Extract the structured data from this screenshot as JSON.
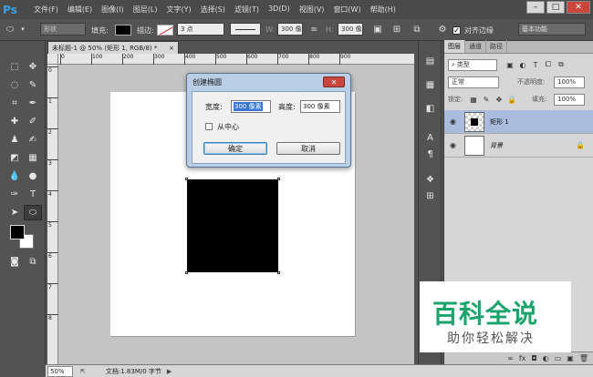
{
  "app": {
    "logo": "Ps"
  },
  "menu": [
    "文件(F)",
    "编辑(E)",
    "图像(I)",
    "图层(L)",
    "文字(Y)",
    "选择(S)",
    "滤镜(T)",
    "3D(D)",
    "视图(V)",
    "窗口(W)",
    "帮助(H)"
  ],
  "window_controls": {
    "minimize": "–",
    "maximize": "□",
    "close": "✕"
  },
  "options": {
    "mode": "形状",
    "fill_label": "填充:",
    "stroke_label": "描边:",
    "stroke_width": "3 点",
    "w_label": "W:",
    "w_value": "300 像",
    "h_label": "H:",
    "h_value": "300 像",
    "align_edges_label": "对齐边缘",
    "workspace": "基本功能"
  },
  "document": {
    "tab_title": "未标题-1 @ 50% (矩形 1, RGB/8) *",
    "tab_close": "×",
    "ruler_h": [
      "0",
      "100",
      "200",
      "300",
      "400",
      "500",
      "600",
      "700",
      "800",
      "900"
    ],
    "ruler_v": [
      "0",
      "1",
      "2",
      "3",
      "4",
      "5",
      "6",
      "7",
      "8"
    ]
  },
  "dialog": {
    "title": "创建椭圆",
    "close": "✕",
    "width_label": "宽度:",
    "width_value": "300 像素",
    "height_label": "高度:",
    "height_value": "300 像素",
    "from_center_label": "从中心",
    "ok_label": "确定",
    "cancel_label": "取消"
  },
  "layers_panel": {
    "tabs": [
      "图层",
      "通道",
      "路径"
    ],
    "filter_kind": "类型",
    "blend_mode": "正常",
    "opacity_label": "不透明度:",
    "opacity_value": "100%",
    "lock_label": "锁定:",
    "fill_label": "填充:",
    "fill_value": "100%",
    "layers": [
      {
        "name": "矩形 1",
        "selected": true
      },
      {
        "name": "背景",
        "selected": false
      }
    ],
    "bottom_icons": [
      "∞",
      "fx",
      "◘",
      "◐",
      "▭",
      "▣",
      "🗑"
    ]
  },
  "watermark": {
    "main": "百科全说",
    "sub": "助你轻松解决"
  },
  "status": {
    "zoom": "50%",
    "doc_info": "文档:1.83M/0 字节",
    "arrow": "▶"
  }
}
